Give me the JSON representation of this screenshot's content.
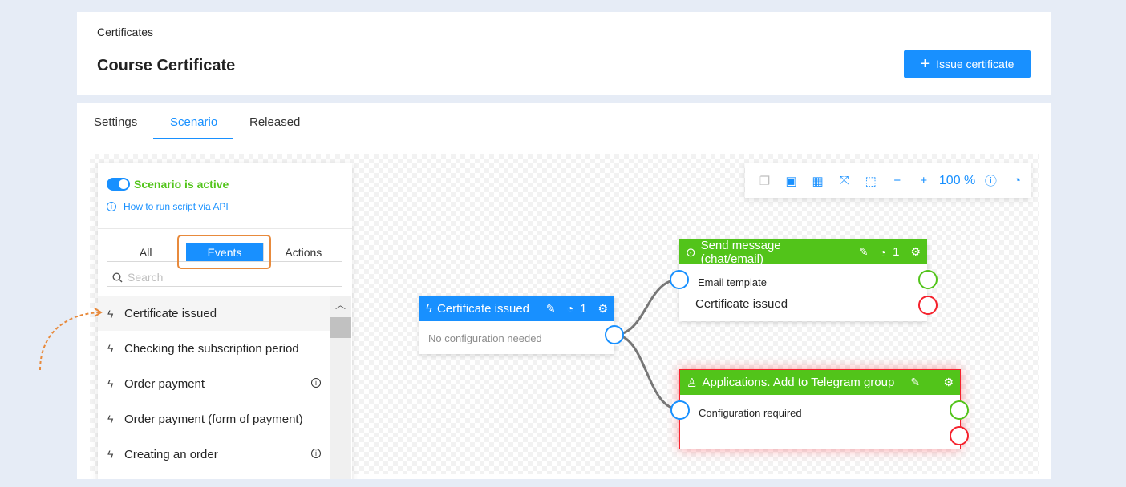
{
  "header": {
    "breadcrumb": "Certificates",
    "title": "Course Certificate",
    "issue_button": "Issue certificate"
  },
  "tabs": [
    "Settings",
    "Scenario",
    "Released"
  ],
  "active_tab": "Scenario",
  "panel": {
    "status": "Scenario is active",
    "api_link": "How to run script via API",
    "filters": [
      "All",
      "Events",
      "Actions"
    ],
    "active_filter": "Events",
    "search_placeholder": "Search",
    "items": [
      {
        "label": "Certificate issued",
        "info": false
      },
      {
        "label": "Checking the subscription period",
        "info": false
      },
      {
        "label": "Order payment",
        "info": true
      },
      {
        "label": "Order payment (form of payment)",
        "info": false
      },
      {
        "label": "Creating an order",
        "info": true
      }
    ]
  },
  "toolbar": {
    "icons": [
      "copy-icon",
      "paste-icon",
      "grid-icon",
      "fit-screen-icon",
      "frame-icon",
      "zoom-out-icon",
      "zoom-in-icon"
    ],
    "zoom": "100 %",
    "help_icon": "help-icon",
    "history_icon": "history-icon"
  },
  "nodes": {
    "trigger": {
      "title": "Certificate issued",
      "count": "1",
      "body": "No configuration needed"
    },
    "send": {
      "title": "Send message (chat/email)",
      "count": "1",
      "sub": "Email template",
      "body": "Certificate issued"
    },
    "telegram": {
      "title": "Applications. Add to Telegram group",
      "sub": "Configuration required"
    }
  },
  "colors": {
    "primary": "#1890ff",
    "success": "#52c41a",
    "error": "#f5222d",
    "highlight": "#e88a3c"
  }
}
